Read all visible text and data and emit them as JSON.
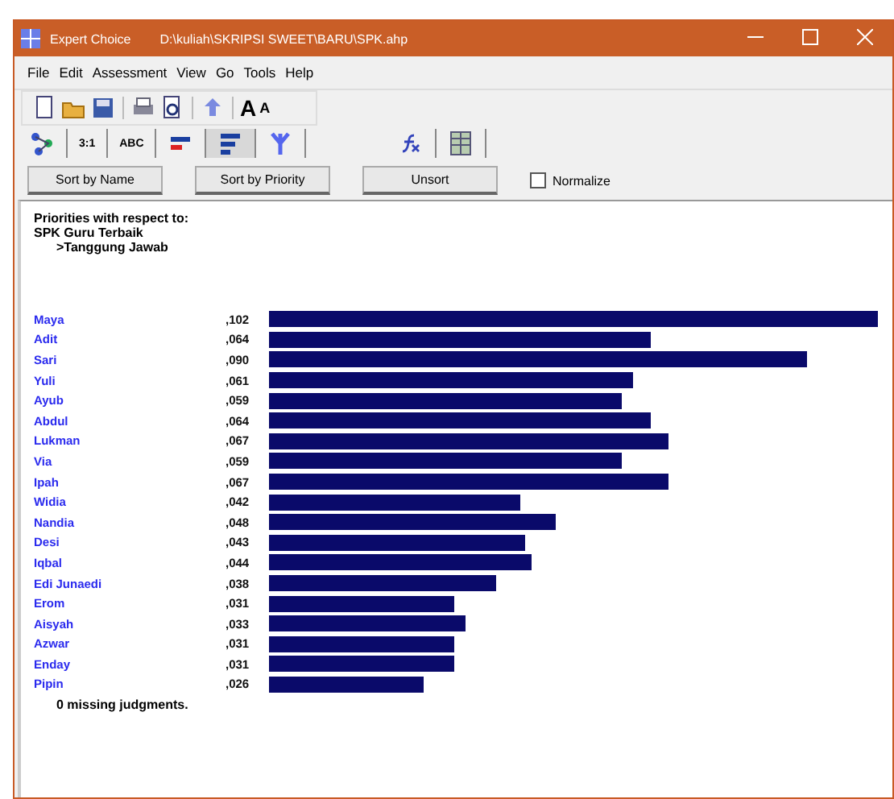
{
  "window": {
    "title": "Expert Choice",
    "path": "D:\\kuliah\\SKRIPSI SWEET\\BARU\\SPK.ahp"
  },
  "menu": [
    "File",
    "Edit",
    "Assessment",
    "View",
    "Go",
    "Tools",
    "Help"
  ],
  "toolbar": [
    {
      "kind": "new"
    },
    {
      "kind": "open"
    },
    {
      "kind": "save"
    },
    {
      "kind": "print"
    },
    {
      "kind": "preview"
    },
    {
      "kind": "up"
    },
    {
      "kind": "font",
      "label": "A"
    },
    {
      "kind": "font-small",
      "label": "A"
    }
  ],
  "tabs": [
    {
      "kind": "tree",
      "selected": false
    },
    {
      "kind": "text",
      "label": "3:1",
      "selected": false
    },
    {
      "kind": "text",
      "label": "ABC",
      "selected": false
    },
    {
      "kind": "bars-red",
      "selected": false
    },
    {
      "kind": "bars-blue",
      "selected": true
    },
    {
      "kind": "fork",
      "selected": false
    },
    {
      "kind": "formula",
      "selected": false
    },
    {
      "kind": "grid",
      "selected": false
    }
  ],
  "buttons": [
    "Sort by Name",
    "Sort by Priority",
    "Unsort"
  ],
  "normalize": {
    "label": "Normalize",
    "checked": false
  },
  "heading": [
    "Priorities with respect to:",
    "SPK Guru Terbaik",
    ">Tanggung Jawab"
  ],
  "rows": [
    {
      "name": "Maya",
      "value": ",102"
    },
    {
      "name": "Adit",
      "value": ",064"
    },
    {
      "name": "Sari",
      "value": ",090"
    },
    {
      "name": "Yuli",
      "value": ",061"
    },
    {
      "name": "Ayub",
      "value": ",059"
    },
    {
      "name": "Abdul",
      "value": ",064"
    },
    {
      "name": "Lukman",
      "value": ",067"
    },
    {
      "name": "Via",
      "value": ",059"
    },
    {
      "name": "Ipah",
      "value": ",067"
    },
    {
      "name": "Widia",
      "value": ",042"
    },
    {
      "name": "Nandia",
      "value": ",048"
    },
    {
      "name": "Desi",
      "value": ",043"
    },
    {
      "name": "Iqbal",
      "value": ",044"
    },
    {
      "name": "Edi Junaedi",
      "value": ",038"
    },
    {
      "name": "Erom",
      "value": ",031"
    },
    {
      "name": "Aisyah",
      "value": ",033"
    },
    {
      "name": "Azwar",
      "value": ",031"
    },
    {
      "name": "Enday",
      "value": ",031"
    },
    {
      "name": "Pipin",
      "value": ",026"
    }
  ],
  "footer": "0  missing judgments."
}
